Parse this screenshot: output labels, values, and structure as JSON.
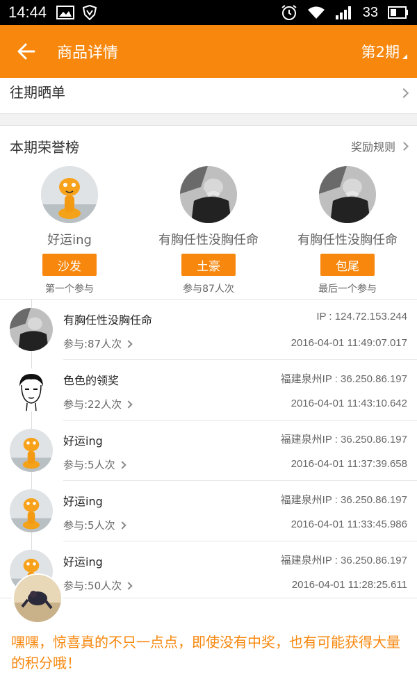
{
  "status_bar": {
    "time": "14:44",
    "battery": "33"
  },
  "header": {
    "title": "商品详情",
    "period": "第2期"
  },
  "past": {
    "label": "往期晒单"
  },
  "honor": {
    "title": "本期荣誉榜",
    "rules_label": "奖励规则",
    "cols": [
      {
        "name": "好运ing",
        "badge": "沙发",
        "sub": "第一个参与",
        "avatar": "garfield"
      },
      {
        "name": "有胸任性没胸任命",
        "badge": "土豪",
        "sub": "参与87人次",
        "avatar": "woman"
      },
      {
        "name": "有胸任性没胸任命",
        "badge": "包尾",
        "sub": "最后一个参与",
        "avatar": "woman"
      }
    ]
  },
  "records": [
    {
      "name": "有胸任性没胸任命",
      "ip": "IP : 124.72.153.244",
      "count": "参与:87人次",
      "time": "2016-04-01 11:49:07.017",
      "avatar": "woman"
    },
    {
      "name": "色色的领奖",
      "ip": "福建泉州IP : 36.250.86.197",
      "count": "参与:22人次",
      "time": "2016-04-01 11:43:10.642",
      "avatar": "sketch"
    },
    {
      "name": "好运ing",
      "ip": "福建泉州IP : 36.250.86.197",
      "count": "参与:5人次",
      "time": "2016-04-01 11:37:39.658",
      "avatar": "garfield"
    },
    {
      "name": "好运ing",
      "ip": "福建泉州IP : 36.250.86.197",
      "count": "参与:5人次",
      "time": "2016-04-01 11:33:45.986",
      "avatar": "garfield"
    },
    {
      "name": "好运ing",
      "ip": "福建泉州IP : 36.250.86.197",
      "count": "参与:50人次",
      "time": "2016-04-01 11:28:25.611",
      "avatar": "garfield"
    }
  ],
  "bottom": {
    "message": "嘿嘿，惊喜真的不只一点点，即使没有中奖，也有可能获得大量的积分哦！"
  },
  "colors": {
    "accent": "#f7870d",
    "text_dark": "#333333",
    "text_muted": "#666666"
  },
  "icons": [
    "back-arrow-icon",
    "chevron-right-icon",
    "dropdown-triangle-icon",
    "wifi-icon",
    "signal-icon",
    "battery-icon",
    "alarm-icon",
    "image-icon",
    "shield-icon"
  ]
}
